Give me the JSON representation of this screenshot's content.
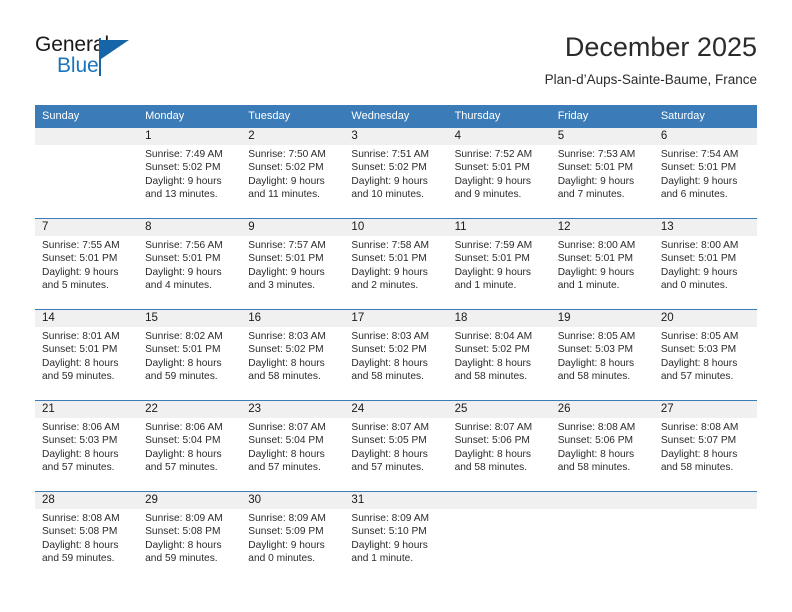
{
  "brand": {
    "name_part1": "General",
    "name_part2": "Blue",
    "logo_icon": "triangle-flag-icon"
  },
  "header": {
    "month_title": "December 2025",
    "location": "Plan-d’Aups-Sainte-Baume, France"
  },
  "calendar": {
    "weekday_headers": [
      "Sunday",
      "Monday",
      "Tuesday",
      "Wednesday",
      "Thursday",
      "Friday",
      "Saturday"
    ],
    "accent_color": "#3b7cb8",
    "daynum_bg": "#f0f0f0",
    "weeks": [
      [
        {
          "day": "",
          "sunrise": "",
          "sunset": "",
          "daylight_line1": "",
          "daylight_line2": ""
        },
        {
          "day": "1",
          "sunrise": "Sunrise: 7:49 AM",
          "sunset": "Sunset: 5:02 PM",
          "daylight_line1": "Daylight: 9 hours",
          "daylight_line2": "and 13 minutes."
        },
        {
          "day": "2",
          "sunrise": "Sunrise: 7:50 AM",
          "sunset": "Sunset: 5:02 PM",
          "daylight_line1": "Daylight: 9 hours",
          "daylight_line2": "and 11 minutes."
        },
        {
          "day": "3",
          "sunrise": "Sunrise: 7:51 AM",
          "sunset": "Sunset: 5:02 PM",
          "daylight_line1": "Daylight: 9 hours",
          "daylight_line2": "and 10 minutes."
        },
        {
          "day": "4",
          "sunrise": "Sunrise: 7:52 AM",
          "sunset": "Sunset: 5:01 PM",
          "daylight_line1": "Daylight: 9 hours",
          "daylight_line2": "and 9 minutes."
        },
        {
          "day": "5",
          "sunrise": "Sunrise: 7:53 AM",
          "sunset": "Sunset: 5:01 PM",
          "daylight_line1": "Daylight: 9 hours",
          "daylight_line2": "and 7 minutes."
        },
        {
          "day": "6",
          "sunrise": "Sunrise: 7:54 AM",
          "sunset": "Sunset: 5:01 PM",
          "daylight_line1": "Daylight: 9 hours",
          "daylight_line2": "and 6 minutes."
        }
      ],
      [
        {
          "day": "7",
          "sunrise": "Sunrise: 7:55 AM",
          "sunset": "Sunset: 5:01 PM",
          "daylight_line1": "Daylight: 9 hours",
          "daylight_line2": "and 5 minutes."
        },
        {
          "day": "8",
          "sunrise": "Sunrise: 7:56 AM",
          "sunset": "Sunset: 5:01 PM",
          "daylight_line1": "Daylight: 9 hours",
          "daylight_line2": "and 4 minutes."
        },
        {
          "day": "9",
          "sunrise": "Sunrise: 7:57 AM",
          "sunset": "Sunset: 5:01 PM",
          "daylight_line1": "Daylight: 9 hours",
          "daylight_line2": "and 3 minutes."
        },
        {
          "day": "10",
          "sunrise": "Sunrise: 7:58 AM",
          "sunset": "Sunset: 5:01 PM",
          "daylight_line1": "Daylight: 9 hours",
          "daylight_line2": "and 2 minutes."
        },
        {
          "day": "11",
          "sunrise": "Sunrise: 7:59 AM",
          "sunset": "Sunset: 5:01 PM",
          "daylight_line1": "Daylight: 9 hours",
          "daylight_line2": "and 1 minute."
        },
        {
          "day": "12",
          "sunrise": "Sunrise: 8:00 AM",
          "sunset": "Sunset: 5:01 PM",
          "daylight_line1": "Daylight: 9 hours",
          "daylight_line2": "and 1 minute."
        },
        {
          "day": "13",
          "sunrise": "Sunrise: 8:00 AM",
          "sunset": "Sunset: 5:01 PM",
          "daylight_line1": "Daylight: 9 hours",
          "daylight_line2": "and 0 minutes."
        }
      ],
      [
        {
          "day": "14",
          "sunrise": "Sunrise: 8:01 AM",
          "sunset": "Sunset: 5:01 PM",
          "daylight_line1": "Daylight: 8 hours",
          "daylight_line2": "and 59 minutes."
        },
        {
          "day": "15",
          "sunrise": "Sunrise: 8:02 AM",
          "sunset": "Sunset: 5:01 PM",
          "daylight_line1": "Daylight: 8 hours",
          "daylight_line2": "and 59 minutes."
        },
        {
          "day": "16",
          "sunrise": "Sunrise: 8:03 AM",
          "sunset": "Sunset: 5:02 PM",
          "daylight_line1": "Daylight: 8 hours",
          "daylight_line2": "and 58 minutes."
        },
        {
          "day": "17",
          "sunrise": "Sunrise: 8:03 AM",
          "sunset": "Sunset: 5:02 PM",
          "daylight_line1": "Daylight: 8 hours",
          "daylight_line2": "and 58 minutes."
        },
        {
          "day": "18",
          "sunrise": "Sunrise: 8:04 AM",
          "sunset": "Sunset: 5:02 PM",
          "daylight_line1": "Daylight: 8 hours",
          "daylight_line2": "and 58 minutes."
        },
        {
          "day": "19",
          "sunrise": "Sunrise: 8:05 AM",
          "sunset": "Sunset: 5:03 PM",
          "daylight_line1": "Daylight: 8 hours",
          "daylight_line2": "and 58 minutes."
        },
        {
          "day": "20",
          "sunrise": "Sunrise: 8:05 AM",
          "sunset": "Sunset: 5:03 PM",
          "daylight_line1": "Daylight: 8 hours",
          "daylight_line2": "and 57 minutes."
        }
      ],
      [
        {
          "day": "21",
          "sunrise": "Sunrise: 8:06 AM",
          "sunset": "Sunset: 5:03 PM",
          "daylight_line1": "Daylight: 8 hours",
          "daylight_line2": "and 57 minutes."
        },
        {
          "day": "22",
          "sunrise": "Sunrise: 8:06 AM",
          "sunset": "Sunset: 5:04 PM",
          "daylight_line1": "Daylight: 8 hours",
          "daylight_line2": "and 57 minutes."
        },
        {
          "day": "23",
          "sunrise": "Sunrise: 8:07 AM",
          "sunset": "Sunset: 5:04 PM",
          "daylight_line1": "Daylight: 8 hours",
          "daylight_line2": "and 57 minutes."
        },
        {
          "day": "24",
          "sunrise": "Sunrise: 8:07 AM",
          "sunset": "Sunset: 5:05 PM",
          "daylight_line1": "Daylight: 8 hours",
          "daylight_line2": "and 57 minutes."
        },
        {
          "day": "25",
          "sunrise": "Sunrise: 8:07 AM",
          "sunset": "Sunset: 5:06 PM",
          "daylight_line1": "Daylight: 8 hours",
          "daylight_line2": "and 58 minutes."
        },
        {
          "day": "26",
          "sunrise": "Sunrise: 8:08 AM",
          "sunset": "Sunset: 5:06 PM",
          "daylight_line1": "Daylight: 8 hours",
          "daylight_line2": "and 58 minutes."
        },
        {
          "day": "27",
          "sunrise": "Sunrise: 8:08 AM",
          "sunset": "Sunset: 5:07 PM",
          "daylight_line1": "Daylight: 8 hours",
          "daylight_line2": "and 58 minutes."
        }
      ],
      [
        {
          "day": "28",
          "sunrise": "Sunrise: 8:08 AM",
          "sunset": "Sunset: 5:08 PM",
          "daylight_line1": "Daylight: 8 hours",
          "daylight_line2": "and 59 minutes."
        },
        {
          "day": "29",
          "sunrise": "Sunrise: 8:09 AM",
          "sunset": "Sunset: 5:08 PM",
          "daylight_line1": "Daylight: 8 hours",
          "daylight_line2": "and 59 minutes."
        },
        {
          "day": "30",
          "sunrise": "Sunrise: 8:09 AM",
          "sunset": "Sunset: 5:09 PM",
          "daylight_line1": "Daylight: 9 hours",
          "daylight_line2": "and 0 minutes."
        },
        {
          "day": "31",
          "sunrise": "Sunrise: 8:09 AM",
          "sunset": "Sunset: 5:10 PM",
          "daylight_line1": "Daylight: 9 hours",
          "daylight_line2": "and 1 minute."
        },
        {
          "day": "",
          "sunrise": "",
          "sunset": "",
          "daylight_line1": "",
          "daylight_line2": ""
        },
        {
          "day": "",
          "sunrise": "",
          "sunset": "",
          "daylight_line1": "",
          "daylight_line2": ""
        },
        {
          "day": "",
          "sunrise": "",
          "sunset": "",
          "daylight_line1": "",
          "daylight_line2": ""
        }
      ]
    ]
  }
}
